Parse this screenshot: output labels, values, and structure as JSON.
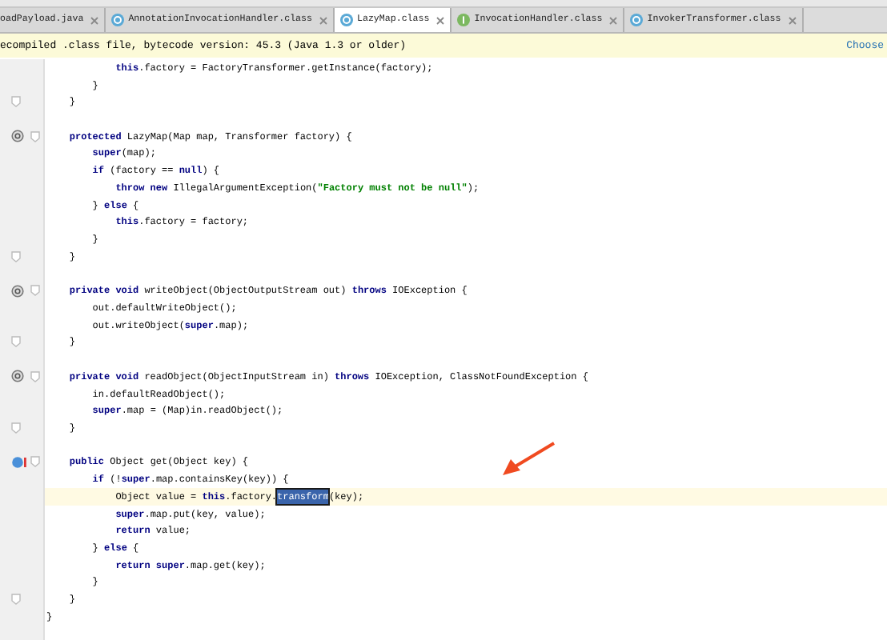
{
  "tabs": [
    {
      "label": "oadPayload.java",
      "kind": "file",
      "selected": false
    },
    {
      "label": "AnnotationInvocationHandler.class",
      "kind": "class",
      "selected": false
    },
    {
      "label": "LazyMap.class",
      "kind": "class",
      "selected": true
    },
    {
      "label": "InvocationHandler.class",
      "kind": "interface",
      "selected": false
    },
    {
      "label": "InvokerTransformer.class",
      "kind": "class",
      "selected": false
    }
  ],
  "banner": {
    "text": "ecompiled .class file, bytecode version: 45.3 (Java 1.3 or older)",
    "action": "Choose"
  },
  "code_lines": [
    {
      "kind": "plain",
      "current": false,
      "tokens": [
        {
          "kind": "keyword",
          "text": "            this"
        },
        {
          "kind": "plain",
          "text": ".factory = FactoryTransformer.getInstance(factory);"
        }
      ]
    },
    {
      "kind": "plain",
      "current": false,
      "tokens": [
        {
          "kind": "plain",
          "text": "        }"
        }
      ]
    },
    {
      "kind": "fold",
      "current": false,
      "tokens": [
        {
          "kind": "plain",
          "text": "    }"
        }
      ]
    },
    {
      "kind": "blank",
      "current": false
    },
    {
      "kind": "override",
      "current": false,
      "tokens": [
        {
          "kind": "keyword",
          "text": "    protected"
        },
        {
          "kind": "plain",
          "text": " LazyMap(Map map, Transformer factory) {"
        }
      ]
    },
    {
      "kind": "plain",
      "current": false,
      "tokens": [
        {
          "kind": "keyword",
          "text": "        super"
        },
        {
          "kind": "plain",
          "text": "(map);"
        }
      ]
    },
    {
      "kind": "plain",
      "current": false,
      "tokens": [
        {
          "kind": "keyword",
          "text": "        if"
        },
        {
          "kind": "plain",
          "text": " (factory == "
        },
        {
          "kind": "keyword",
          "text": "null"
        },
        {
          "kind": "plain",
          "text": ") {"
        }
      ]
    },
    {
      "kind": "plain",
      "current": false,
      "tokens": [
        {
          "kind": "keyword",
          "text": "            throw new"
        },
        {
          "kind": "plain",
          "text": " IllegalArgumentException("
        },
        {
          "kind": "string",
          "text": "\"Factory must not be null\""
        },
        {
          "kind": "plain",
          "text": ");"
        }
      ]
    },
    {
      "kind": "plain",
      "current": false,
      "tokens": [
        {
          "kind": "plain",
          "text": "        } "
        },
        {
          "kind": "keyword",
          "text": "else"
        },
        {
          "kind": "plain",
          "text": " {"
        }
      ]
    },
    {
      "kind": "plain",
      "current": false,
      "tokens": [
        {
          "kind": "keyword",
          "text": "            this"
        },
        {
          "kind": "plain",
          "text": ".factory = factory;"
        }
      ]
    },
    {
      "kind": "plain",
      "current": false,
      "tokens": [
        {
          "kind": "plain",
          "text": "        }"
        }
      ]
    },
    {
      "kind": "fold",
      "current": false,
      "tokens": [
        {
          "kind": "plain",
          "text": "    }"
        }
      ]
    },
    {
      "kind": "blank",
      "current": false
    },
    {
      "kind": "override",
      "current": false,
      "tokens": [
        {
          "kind": "keyword",
          "text": "    private void"
        },
        {
          "kind": "plain",
          "text": " writeObject(ObjectOutputStream out) "
        },
        {
          "kind": "keyword",
          "text": "throws"
        },
        {
          "kind": "plain",
          "text": " IOException {"
        }
      ]
    },
    {
      "kind": "plain",
      "current": false,
      "tokens": [
        {
          "kind": "plain",
          "text": "        out.defaultWriteObject();"
        }
      ]
    },
    {
      "kind": "plain",
      "current": false,
      "tokens": [
        {
          "kind": "plain",
          "text": "        out.writeObject("
        },
        {
          "kind": "keyword",
          "text": "super"
        },
        {
          "kind": "plain",
          "text": ".map);"
        }
      ]
    },
    {
      "kind": "fold",
      "current": false,
      "tokens": [
        {
          "kind": "plain",
          "text": "    }"
        }
      ]
    },
    {
      "kind": "blank",
      "current": false
    },
    {
      "kind": "override",
      "current": false,
      "tokens": [
        {
          "kind": "keyword",
          "text": "    private void"
        },
        {
          "kind": "plain",
          "text": " readObject(ObjectInputStream in) "
        },
        {
          "kind": "keyword",
          "text": "throws"
        },
        {
          "kind": "plain",
          "text": " IOException, ClassNotFoundException {"
        }
      ]
    },
    {
      "kind": "plain",
      "current": false,
      "tokens": [
        {
          "kind": "plain",
          "text": "        in.defaultReadObject();"
        }
      ]
    },
    {
      "kind": "plain",
      "current": false,
      "tokens": [
        {
          "kind": "keyword",
          "text": "        super"
        },
        {
          "kind": "plain",
          "text": ".map = (Map)in.readObject();"
        }
      ]
    },
    {
      "kind": "fold",
      "current": false,
      "tokens": [
        {
          "kind": "plain",
          "text": "    }"
        }
      ]
    },
    {
      "kind": "blank",
      "current": false
    },
    {
      "kind": "breakpoint",
      "current": false,
      "tokens": [
        {
          "kind": "keyword",
          "text": "    public"
        },
        {
          "kind": "plain",
          "text": " Object get(Object key) {"
        }
      ]
    },
    {
      "kind": "plain",
      "current": false,
      "tokens": [
        {
          "kind": "keyword",
          "text": "        if"
        },
        {
          "kind": "plain",
          "text": " (!"
        },
        {
          "kind": "keyword",
          "text": "super"
        },
        {
          "kind": "plain",
          "text": ".map.containsKey(key)) {"
        }
      ]
    },
    {
      "kind": "plain",
      "current": true,
      "tokens": [
        {
          "kind": "plain",
          "text": "            Object value = "
        },
        {
          "kind": "keyword",
          "text": "this"
        },
        {
          "kind": "plain",
          "text": ".factory."
        },
        {
          "kind": "selection",
          "text": "transform"
        },
        {
          "kind": "plain",
          "text": "(key);"
        }
      ]
    },
    {
      "kind": "plain",
      "current": false,
      "tokens": [
        {
          "kind": "keyword",
          "text": "            super"
        },
        {
          "kind": "plain",
          "text": ".map.put(key, value);"
        }
      ]
    },
    {
      "kind": "plain",
      "current": false,
      "tokens": [
        {
          "kind": "keyword",
          "text": "            return"
        },
        {
          "kind": "plain",
          "text": " value;"
        }
      ]
    },
    {
      "kind": "plain",
      "current": false,
      "tokens": [
        {
          "kind": "plain",
          "text": "        } "
        },
        {
          "kind": "keyword",
          "text": "else"
        },
        {
          "kind": "plain",
          "text": " {"
        }
      ]
    },
    {
      "kind": "plain",
      "current": false,
      "tokens": [
        {
          "kind": "keyword",
          "text": "            return super"
        },
        {
          "kind": "plain",
          "text": ".map.get(key);"
        }
      ]
    },
    {
      "kind": "plain",
      "current": false,
      "tokens": [
        {
          "kind": "plain",
          "text": "        }"
        }
      ]
    },
    {
      "kind": "fold",
      "current": false,
      "tokens": [
        {
          "kind": "plain",
          "text": "    }"
        }
      ]
    },
    {
      "kind": "plain",
      "current": false,
      "tokens": [
        {
          "kind": "plain",
          "text": "}"
        }
      ]
    }
  ]
}
